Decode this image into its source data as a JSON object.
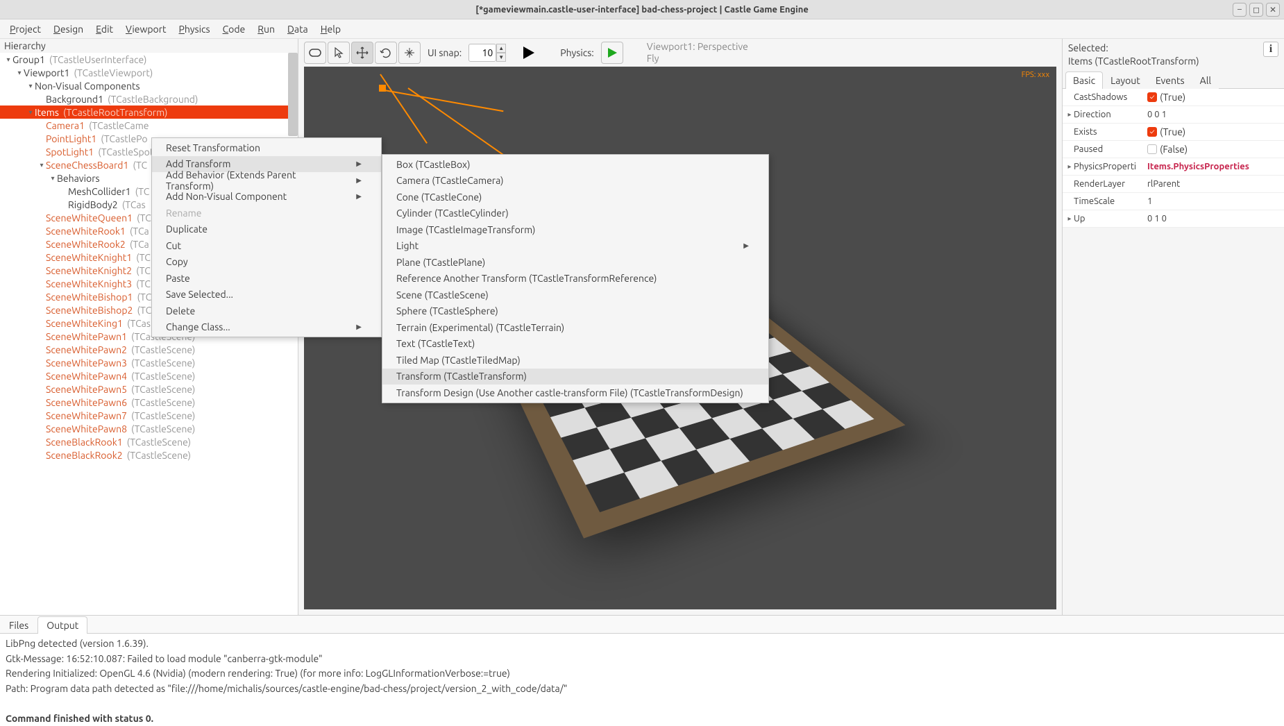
{
  "window_title": "[*gameviewmain.castle-user-interface] bad-chess-project | Castle Game Engine",
  "menubar": [
    "Project",
    "Design",
    "Edit",
    "Viewport",
    "Physics",
    "Code",
    "Run",
    "Data",
    "Help"
  ],
  "hierarchy_header": "Hierarchy",
  "hierarchy": {
    "nodes": [
      {
        "indent": 0,
        "exp": "down",
        "main": "Group1",
        "cls": "(TCastleUserInterface)",
        "sel": false,
        "tfm": false
      },
      {
        "indent": 1,
        "exp": "down",
        "main": "Viewport1",
        "cls": "(TCastleViewport)",
        "sel": false,
        "tfm": false
      },
      {
        "indent": 2,
        "exp": "down",
        "main": "Non-Visual Components",
        "cls": "",
        "sel": false,
        "tfm": false
      },
      {
        "indent": 3,
        "exp": "none",
        "main": "Background1",
        "cls": "(TCastleBackground)",
        "sel": false,
        "tfm": false
      },
      {
        "indent": 2,
        "exp": "down",
        "main": "Items",
        "cls": "(TCastleRootTransform)",
        "sel": true,
        "tfm": true
      },
      {
        "indent": 3,
        "exp": "none",
        "main": "Camera1",
        "cls": "(TCastleCame",
        "sel": false,
        "tfm": true
      },
      {
        "indent": 3,
        "exp": "none",
        "main": "PointLight1",
        "cls": "(TCastlePo",
        "sel": false,
        "tfm": true
      },
      {
        "indent": 3,
        "exp": "none",
        "main": "SpotLight1",
        "cls": "(TCastleSpot",
        "sel": false,
        "tfm": true
      },
      {
        "indent": 3,
        "exp": "down",
        "main": "SceneChessBoard1",
        "cls": "(TC",
        "sel": false,
        "tfm": true
      },
      {
        "indent": 4,
        "exp": "down",
        "main": "Behaviors",
        "cls": "",
        "sel": false,
        "tfm": false
      },
      {
        "indent": 5,
        "exp": "none",
        "main": "MeshCollider1",
        "cls": "(TC",
        "sel": false,
        "tfm": false
      },
      {
        "indent": 5,
        "exp": "none",
        "main": "RigidBody2",
        "cls": "(TCas",
        "sel": false,
        "tfm": false
      },
      {
        "indent": 3,
        "exp": "none",
        "main": "SceneWhiteQueen1",
        "cls": "(TC",
        "sel": false,
        "tfm": true
      },
      {
        "indent": 3,
        "exp": "none",
        "main": "SceneWhiteRook1",
        "cls": "(TCa",
        "sel": false,
        "tfm": true
      },
      {
        "indent": 3,
        "exp": "none",
        "main": "SceneWhiteRook2",
        "cls": "(TCa",
        "sel": false,
        "tfm": true
      },
      {
        "indent": 3,
        "exp": "none",
        "main": "SceneWhiteKnight1",
        "cls": "(TC",
        "sel": false,
        "tfm": true
      },
      {
        "indent": 3,
        "exp": "none",
        "main": "SceneWhiteKnight2",
        "cls": "(TC",
        "sel": false,
        "tfm": true
      },
      {
        "indent": 3,
        "exp": "none",
        "main": "SceneWhiteKnight3",
        "cls": "(TC",
        "sel": false,
        "tfm": true
      },
      {
        "indent": 3,
        "exp": "none",
        "main": "SceneWhiteBishop1",
        "cls": "(TC",
        "sel": false,
        "tfm": true
      },
      {
        "indent": 3,
        "exp": "none",
        "main": "SceneWhiteBishop2",
        "cls": "(TC",
        "sel": false,
        "tfm": true
      },
      {
        "indent": 3,
        "exp": "none",
        "main": "SceneWhiteKing1",
        "cls": "(TCastleScene)",
        "sel": false,
        "tfm": true
      },
      {
        "indent": 3,
        "exp": "none",
        "main": "SceneWhitePawn1",
        "cls": "(TCastleScene)",
        "sel": false,
        "tfm": true
      },
      {
        "indent": 3,
        "exp": "none",
        "main": "SceneWhitePawn2",
        "cls": "(TCastleScene)",
        "sel": false,
        "tfm": true
      },
      {
        "indent": 3,
        "exp": "none",
        "main": "SceneWhitePawn3",
        "cls": "(TCastleScene)",
        "sel": false,
        "tfm": true
      },
      {
        "indent": 3,
        "exp": "none",
        "main": "SceneWhitePawn4",
        "cls": "(TCastleScene)",
        "sel": false,
        "tfm": true
      },
      {
        "indent": 3,
        "exp": "none",
        "main": "SceneWhitePawn5",
        "cls": "(TCastleScene)",
        "sel": false,
        "tfm": true
      },
      {
        "indent": 3,
        "exp": "none",
        "main": "SceneWhitePawn6",
        "cls": "(TCastleScene)",
        "sel": false,
        "tfm": true
      },
      {
        "indent": 3,
        "exp": "none",
        "main": "SceneWhitePawn7",
        "cls": "(TCastleScene)",
        "sel": false,
        "tfm": true
      },
      {
        "indent": 3,
        "exp": "none",
        "main": "SceneWhitePawn8",
        "cls": "(TCastleScene)",
        "sel": false,
        "tfm": true
      },
      {
        "indent": 3,
        "exp": "none",
        "main": "SceneBlackRook1",
        "cls": "(TCastleScene)",
        "sel": false,
        "tfm": true
      },
      {
        "indent": 3,
        "exp": "none",
        "main": "SceneBlackRook2",
        "cls": "(TCastleScene)",
        "sel": false,
        "tfm": true
      }
    ]
  },
  "toolbar": {
    "ui_snap_label": "UI snap:",
    "ui_snap_value": "10",
    "physics_label": "Physics:",
    "status1": "Viewport1: Perspective",
    "status2": "Fly",
    "fps": "FPS: xxx"
  },
  "inspector": {
    "header1": "Selected:",
    "header2": "Items (TCastleRootTransform)",
    "tabs": [
      "Basic",
      "Layout",
      "Events",
      "All"
    ],
    "props": [
      {
        "exp": "",
        "name": "CastShadows",
        "type": "check",
        "checked": true,
        "valtext": "(True)"
      },
      {
        "exp": "▸",
        "name": "Direction",
        "type": "text",
        "valtext": "0 0 1"
      },
      {
        "exp": "",
        "name": "Exists",
        "type": "check",
        "checked": true,
        "valtext": "(True)"
      },
      {
        "exp": "",
        "name": "Paused",
        "type": "check",
        "checked": false,
        "valtext": "(False)"
      },
      {
        "exp": "▸",
        "name": "PhysicsProperti",
        "type": "link",
        "valtext": "Items.PhysicsProperties"
      },
      {
        "exp": "",
        "name": "RenderLayer",
        "type": "text",
        "valtext": "rlParent"
      },
      {
        "exp": "",
        "name": "TimeScale",
        "type": "text",
        "valtext": "1"
      },
      {
        "exp": "▸",
        "name": "Up",
        "type": "text",
        "valtext": "0 1 0"
      }
    ]
  },
  "bottom": {
    "tabs": [
      "Files",
      "Output"
    ],
    "lines": [
      "LibPng detected (version 1.6.39).",
      "Gtk-Message: 16:52:10.087: Failed to load module \"canberra-gtk-module\"",
      "Rendering Initialized: OpenGL 4.6 (Nvidia) (modern rendering: True) (for more info: LogGLInformationVerbose:=true)",
      "Path: Program data path detected as \"file:///home/michalis/sources/castle-engine/bad-chess/project/version_2_with_code/data/\""
    ],
    "final": "Command finished with status 0."
  },
  "ctx1": [
    {
      "label": "Reset Transformation",
      "sub": false,
      "hl": false,
      "dis": false
    },
    {
      "label": "Add Transform",
      "sub": true,
      "hl": true,
      "dis": false
    },
    {
      "label": "Add Behavior (Extends Parent Transform)",
      "sub": true,
      "hl": false,
      "dis": false
    },
    {
      "label": "Add Non-Visual Component",
      "sub": true,
      "hl": false,
      "dis": false
    },
    {
      "label": "Rename",
      "sub": false,
      "hl": false,
      "dis": true
    },
    {
      "label": "Duplicate",
      "sub": false,
      "hl": false,
      "dis": false
    },
    {
      "label": "Cut",
      "sub": false,
      "hl": false,
      "dis": false
    },
    {
      "label": "Copy",
      "sub": false,
      "hl": false,
      "dis": false
    },
    {
      "label": "Paste",
      "sub": false,
      "hl": false,
      "dis": false
    },
    {
      "label": "Save Selected...",
      "sub": false,
      "hl": false,
      "dis": false
    },
    {
      "label": "Delete",
      "sub": false,
      "hl": false,
      "dis": false
    },
    {
      "label": "Change Class...",
      "sub": true,
      "hl": false,
      "dis": false
    }
  ],
  "ctx2": [
    {
      "label": "Box (TCastleBox)",
      "sub": false,
      "hl": false
    },
    {
      "label": "Camera (TCastleCamera)",
      "sub": false,
      "hl": false
    },
    {
      "label": "Cone (TCastleCone)",
      "sub": false,
      "hl": false
    },
    {
      "label": "Cylinder (TCastleCylinder)",
      "sub": false,
      "hl": false
    },
    {
      "label": "Image (TCastleImageTransform)",
      "sub": false,
      "hl": false
    },
    {
      "label": "Light",
      "sub": true,
      "hl": false
    },
    {
      "label": "Plane (TCastlePlane)",
      "sub": false,
      "hl": false
    },
    {
      "label": "Reference Another Transform (TCastleTransformReference)",
      "sub": false,
      "hl": false
    },
    {
      "label": "Scene (TCastleScene)",
      "sub": false,
      "hl": false
    },
    {
      "label": "Sphere (TCastleSphere)",
      "sub": false,
      "hl": false
    },
    {
      "label": "Terrain (Experimental) (TCastleTerrain)",
      "sub": false,
      "hl": false
    },
    {
      "label": "Text (TCastleText)",
      "sub": false,
      "hl": false
    },
    {
      "label": "Tiled Map (TCastleTiledMap)",
      "sub": false,
      "hl": false
    },
    {
      "label": "Transform (TCastleTransform)",
      "sub": false,
      "hl": true
    },
    {
      "label": "Transform Design (Use Another castle-transform File) (TCastleTransformDesign)",
      "sub": false,
      "hl": false
    }
  ]
}
